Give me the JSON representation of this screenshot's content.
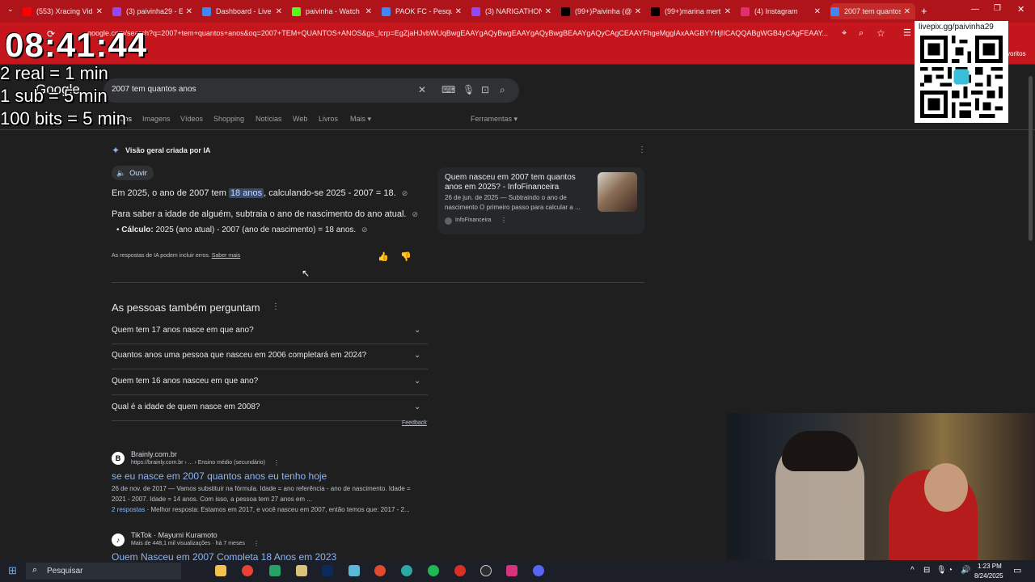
{
  "tabs": [
    {
      "label": "(553) Xracing Vid",
      "color": "#ff0000"
    },
    {
      "label": "(3) paivinha29 - E",
      "color": "#9146ff"
    },
    {
      "label": "Dashboard - Live",
      "color": "#4285f4"
    },
    {
      "label": "paivinha - Watch",
      "color": "#53fc18"
    },
    {
      "label": "PAOK FC - Pesqui",
      "color": "#4285f4"
    },
    {
      "label": "(3) NARIGATHON",
      "color": "#9146ff"
    },
    {
      "label": "(99+)Paivinha (@",
      "color": "#000000"
    },
    {
      "label": "(99+)marina mert",
      "color": "#000000"
    },
    {
      "label": "(4) Instagram",
      "color": "#e1306c"
    },
    {
      "label": "2007 tem quantos",
      "color": "#4285f4"
    }
  ],
  "browser": {
    "url": "google.com/search?q=2007+tem+quantos+anos&oq=2007+TEM+QUANTOS+ANOS&gs_lcrp=EgZjaHJvbWUqBwgEAAYgAQyBwgEAAYgAQyBwgBEAAYgAQyCAgCEAAYFhgeMggIAxAAGBYYHjIICAQQABgWGB4yCAgFEAAY...",
    "favorites": "voritos"
  },
  "search": {
    "logo": "Google",
    "query": "2007 tem quantos anos",
    "tabs": [
      "Todos",
      "Imagens",
      "Vídeos",
      "Shopping",
      "Notícias",
      "Web",
      "Livros",
      "Mais"
    ],
    "tools": "Ferramentas"
  },
  "ai_overview": {
    "title": "Visão geral criada por IA",
    "listen": "Ouvir",
    "line1_pre": "Em 2025, o ano de 2007 tem ",
    "line1_highlight": "18 anos",
    "line1_post": ", calculando-se 2025 - 2007 = 18.",
    "line2": "Para saber a idade de alguém, subtraia o ano de nascimento do ano atual.",
    "bullet_label": "Cálculo:",
    "bullet_text": "2025 (ano atual) - 2007 (ano de nascimento) = 18 anos.",
    "disclaimer": "As respostas de IA podem incluir erros.",
    "learn_more": "Saber mais",
    "source": {
      "title_line1": "Quem nasceu em 2007 tem quantos",
      "title_line2": "anos em 2025? - InfoFinanceira",
      "snippet_line1": "26 de jun. de 2025 — Subtraindo o ano de",
      "snippet_line2": "nascimento O primeiro passo para calcular a ...",
      "site": "InfoFinanceira"
    }
  },
  "paa": {
    "title": "As pessoas também perguntam",
    "questions": [
      "Quem tem 17 anos nasce em que ano?",
      "Quantos anos uma pessoa que nasceu em 2006 completará em 2024?",
      "Quem tem 16 anos nasceu em que ano?",
      "Qual é a idade de quem nasce em 2008?"
    ],
    "feedback": "Feedback"
  },
  "results": [
    {
      "favicon": "B",
      "site": "Brainly.com.br",
      "breadcrumb": "https://brainly.com.br › ... › Ensino médio (secundário)",
      "title": "se eu nasce em 2007 quantos anos eu tenho hoje",
      "snippet1": "26 de nov. de 2017 — Vamos substituir na fórmula. Idade = ano referência - ano de nascimento. Idade =",
      "snippet2": "2021 - 2007. Idade = 14 anos. Com isso, a pessoa tem 27 anos em ...",
      "answers_link": "2 respostas",
      "answers_text": "· Melhor resposta: Estamos em 2017, e você nasceu em 2007, então temos que: 2017 - 2..."
    },
    {
      "favicon": "♪",
      "site": "TikTok · Mayumi Kuramoto",
      "meta": "Mais de 448,1 mil visualizações · há 7 meses",
      "title": "Quem Nasceu em 2007 Completa 18 Anos em 2023"
    }
  ],
  "overlay": {
    "clock": "08:41:44",
    "lines": [
      "2 real = 1 min",
      "1 sub = 5 min",
      "100 bits = 5 min"
    ],
    "qr_label": "livepix.gg/paivinha29"
  },
  "taskbar": {
    "search": "Pesquisar",
    "time": "1:23 PM",
    "date": "8/24/2025"
  }
}
